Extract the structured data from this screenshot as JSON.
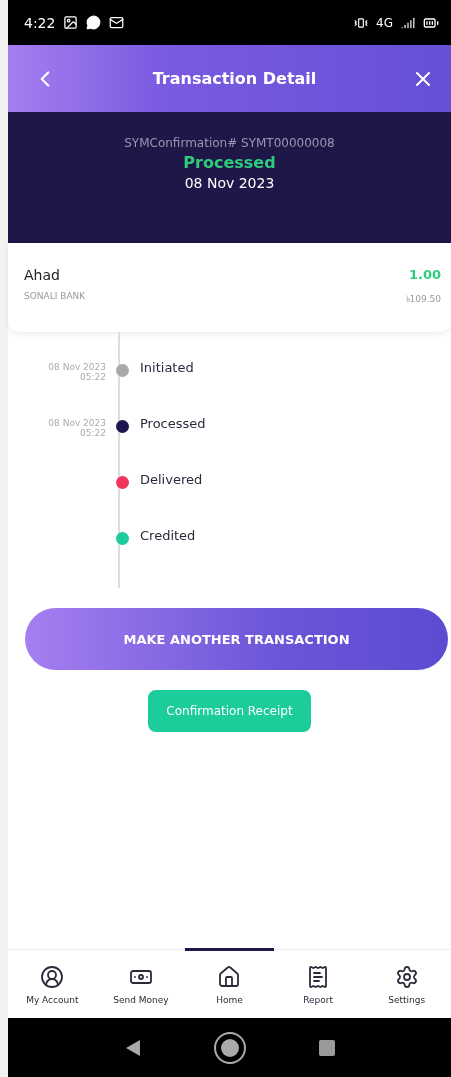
{
  "status_bar": {
    "time": "4:22",
    "network": "4G"
  },
  "header": {
    "title": "Transaction Detail"
  },
  "summary": {
    "confirmation": "SYMConfirmation# SYMT00000008",
    "status": "Processed",
    "date": "08 Nov 2023"
  },
  "recipient": {
    "name": "Ahad",
    "bank": "SONALI BANK",
    "amount": "1.00",
    "local_amount": "৳109.50"
  },
  "timeline": [
    {
      "label": "Initiated",
      "date": "08 Nov 2023",
      "time": "05:22",
      "color": "#a9a9a9"
    },
    {
      "label": "Processed",
      "date": "08 Nov 2023",
      "time": "05:22",
      "color": "#1e1650"
    },
    {
      "label": "Delivered",
      "color": "#f0365f"
    },
    {
      "label": "Credited",
      "color": "#1dcc9b"
    }
  ],
  "primary_button": "MAKE ANOTHER TRANSACTION",
  "receipt_button": "Confirmation Receipt",
  "bottom_nav": [
    {
      "label": "My Account",
      "selected": false
    },
    {
      "label": "Send Money",
      "selected": false
    },
    {
      "label": "Home",
      "selected": true
    },
    {
      "label": "Report",
      "selected": false
    },
    {
      "label": "Settings",
      "selected": false
    }
  ]
}
